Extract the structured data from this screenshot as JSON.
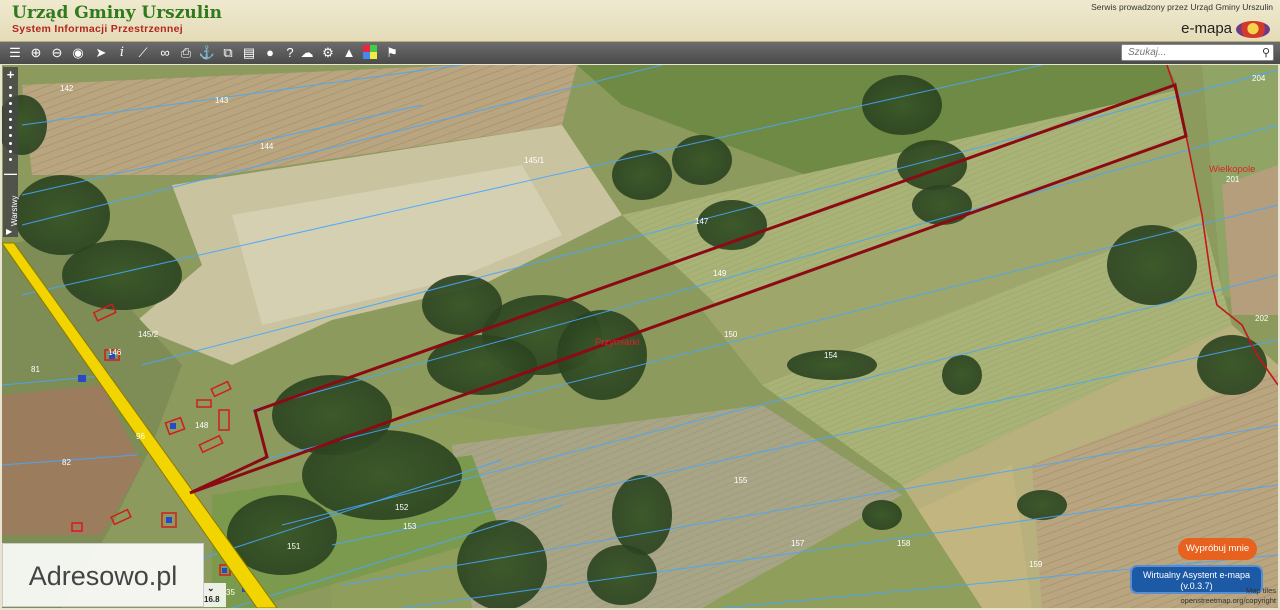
{
  "header": {
    "title": "Urząd Gminy Urszulin",
    "subtitle": "System Informacji Przestrzennej",
    "service_text": "Serwis prowadzony przez Urząd Gminy Urszulin",
    "brand": "e-mapa"
  },
  "toolbar": {
    "tools": [
      "layers-icon",
      "zoom-in-icon",
      "zoom-out-icon",
      "zoom-extent-icon",
      "select-icon",
      "info-icon",
      "measure-icon",
      "link-icon",
      "print-icon",
      "anchor-icon",
      "copy-icon",
      "layout-icon",
      "comment-icon",
      "help-icon",
      "cloud-download-icon",
      "settings-icon",
      "triangle-icon",
      "colors-icon",
      "pin-icon"
    ],
    "search_placeholder": "Szukaj..."
  },
  "map_controls": {
    "zoom_in": "+",
    "zoom_out": "—",
    "layers_label": "Warstwy"
  },
  "parcels": [
    "142",
    "143",
    "144",
    "145/1",
    "147",
    "149",
    "150",
    "154",
    "155",
    "157",
    "158",
    "159",
    "145/2",
    "146",
    "148",
    "152",
    "153",
    "151",
    "96",
    "81",
    "82",
    "204",
    "201",
    "202",
    "35"
  ],
  "place_labels": [
    "Przymiarki",
    "Wielkopole"
  ],
  "watermark": "Adresowo.pl",
  "scale": {
    "value": "16.8"
  },
  "buttons": {
    "try": "Wypróbuj mnie",
    "assistant_line1": "Wirtualny Asystent e-mapa",
    "assistant_line2": "(v.0.3.7)"
  },
  "attribution": {
    "line1": "Map tiles",
    "line2": "openstreetmap.org/copyright"
  },
  "colors": {
    "header_title": "#2f7a1c",
    "subtitle": "#b3261e",
    "parcel_line": "#3fa0ff",
    "highlight": "#8b0a14",
    "road": "#f2d400"
  }
}
